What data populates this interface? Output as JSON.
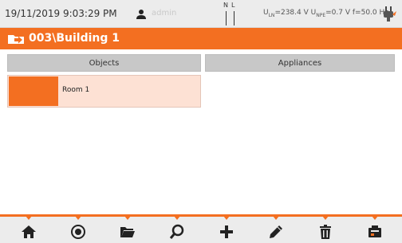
{
  "status_bar": {
    "datetime": "19/11/2019 9:03:29 PM",
    "user": "admin",
    "nl_labels": {
      "n": "N",
      "l": "L"
    },
    "measurement": {
      "uln_label": "U",
      "uln_sub": "LN",
      "uln_value": "=238.4 V",
      "unpe_label": "U",
      "unpe_sub": "NPE",
      "unpe_value": "=0.7 V",
      "freq": "f=50.0 Hz"
    },
    "icons": [
      "user-icon",
      "nl-connection-icon",
      "plug-icon"
    ]
  },
  "title_bar": {
    "title": "003\\Building 1",
    "icon": "folder-arrow-icon"
  },
  "tabs": [
    {
      "label": "Objects",
      "active": true
    },
    {
      "label": "Appliances",
      "active": false
    }
  ],
  "objects": [
    {
      "name": "Room 1"
    }
  ],
  "toolbar": {
    "items": [
      {
        "icon": "home-icon"
      },
      {
        "icon": "up-circle-icon"
      },
      {
        "icon": "folder-icon"
      },
      {
        "icon": "search-icon"
      },
      {
        "icon": "add-icon"
      },
      {
        "icon": "edit-icon"
      },
      {
        "icon": "delete-icon"
      },
      {
        "icon": "device-icon"
      }
    ]
  },
  "colors": {
    "accent": "#f36f21",
    "selected_row": "#fde1d4",
    "tab_bg": "#c8c8c8",
    "statusbar_bg": "#ececec"
  }
}
